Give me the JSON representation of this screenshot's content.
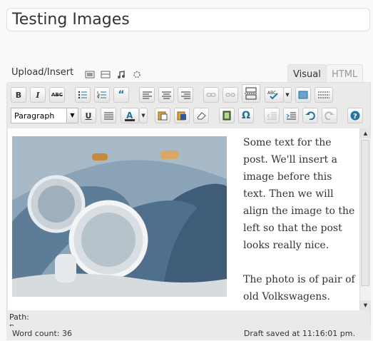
{
  "post": {
    "title": "Testing Images"
  },
  "media": {
    "upload_label": "Upload/Insert"
  },
  "tabs": [
    {
      "label": "Visual"
    },
    {
      "label": "HTML"
    }
  ],
  "toolbar": {
    "format_select": "Paragraph"
  },
  "content": {
    "paragraphs": [
      "Some text for the post. We'll insert a image before this text. Then we will align the image to the left so that the post looks really nice.",
      "The photo is of pair of old Volkswagens."
    ]
  },
  "status": {
    "path": "Path: p",
    "word_count": "Word count: 36",
    "draft": "Draft saved at 11:16:01 pm."
  },
  "colors": {
    "accent": "#21759b",
    "toolbar_bg": "#eaeaea"
  }
}
